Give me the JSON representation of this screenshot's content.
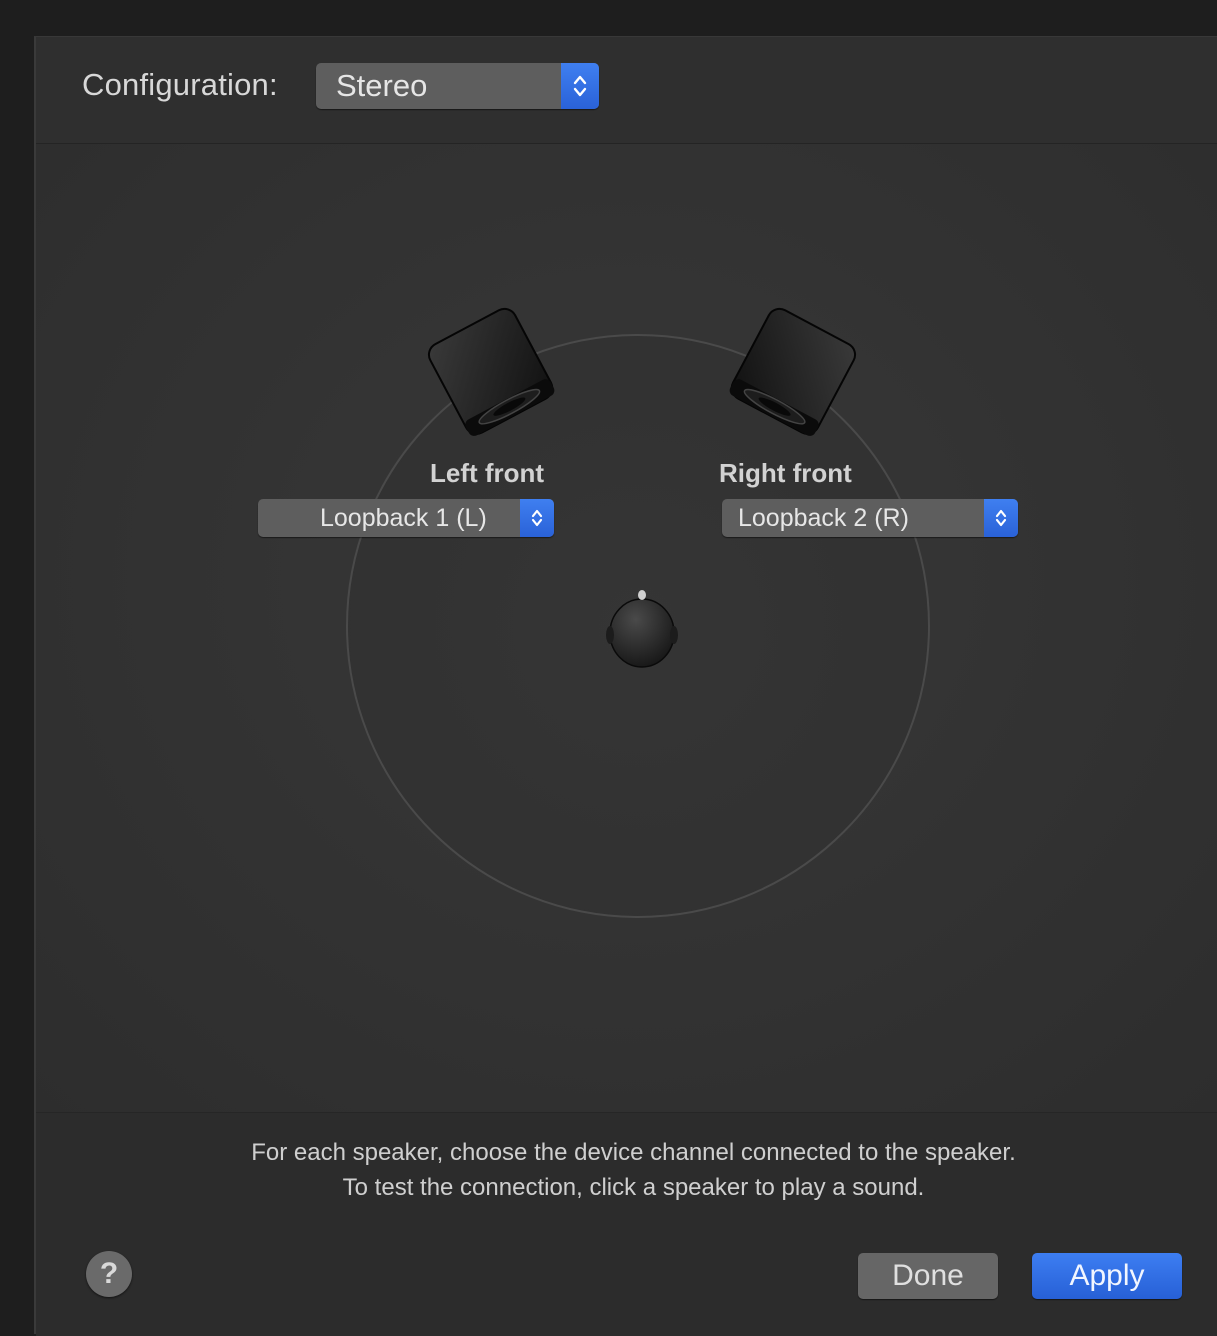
{
  "configuration": {
    "label": "Configuration:",
    "selected": "Stereo"
  },
  "speakers": {
    "left": {
      "label": "Left front",
      "channel": "Loopback 1 (L)"
    },
    "right": {
      "label": "Right front",
      "channel": "Loopback 2 (R)"
    }
  },
  "instructions": {
    "line1": "For each speaker, choose the device channel connected to the speaker.",
    "line2": "To test the connection, click a speaker to play a sound."
  },
  "buttons": {
    "help": "?",
    "done": "Done",
    "apply": "Apply"
  },
  "colors": {
    "accent": "#2f6be0",
    "background": "#2c2c2c"
  },
  "icons": {
    "popup_arrows": "up-down-chevron-icon",
    "speaker": "speaker-icon",
    "listener": "listener-head-icon"
  }
}
